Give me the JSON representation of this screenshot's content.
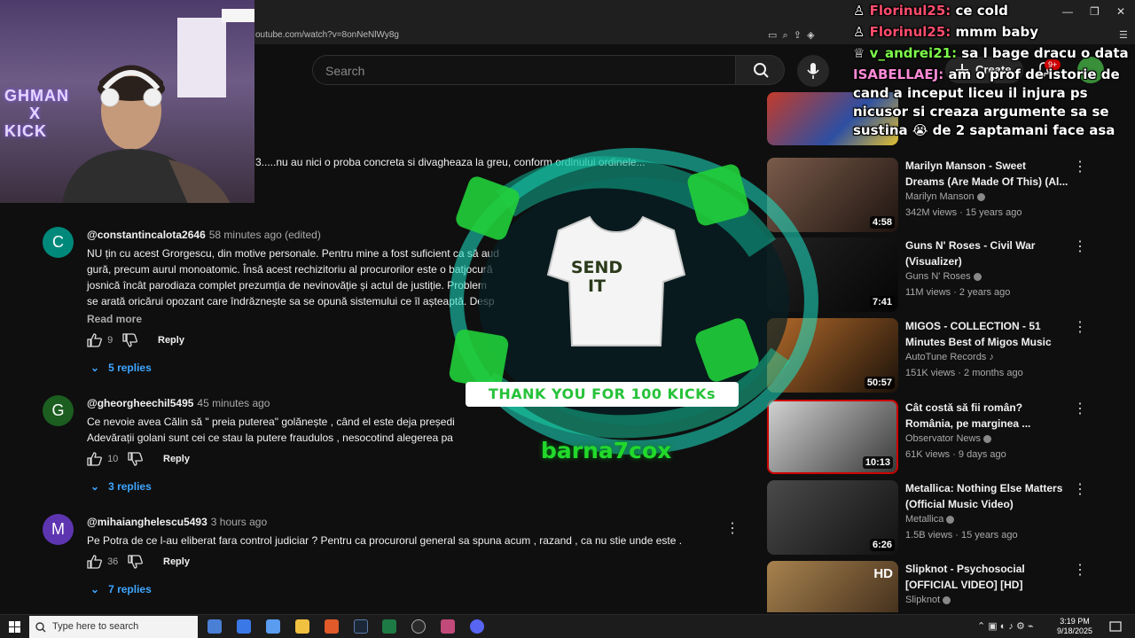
{
  "browser": {
    "url": "outube.com/watch?v=8onNeNlWy8g"
  },
  "header": {
    "search_placeholder": "Search",
    "create_label": "Create",
    "notif_badge": "9+"
  },
  "cut_comment_text": "3.....nu au  nici o proba concreta si divagheaza la greu, conform ordinului ordinele...",
  "comments": [
    {
      "initial": "C",
      "avatar_color": "#00897b",
      "author": "@constantincalota2646",
      "time": "58 minutes ago (edited)",
      "lines": [
        "NU țin cu acest Grorgescu, din motive personale. Pentru mine a fost suficient ca să aud",
        "gură, precum aurul monoatomic. Însă acest rechizitoriu al procurorilor este o batjocură",
        "josnică încât parodiaza complet prezumția de nevinovăție și actul de justiție. Problem",
        "se arată oricărui opozant care îndrăznește sa se opună sistemului ce îl așteaptă. Desp"
      ],
      "read_more": "Read more",
      "likes": "9",
      "reply": "Reply",
      "replies": "5 replies"
    },
    {
      "initial": "G",
      "avatar_color": "#1b5e20",
      "author": "@gheorgheechil5495",
      "time": "45 minutes ago",
      "lines": [
        "Ce nevoie avea Călin să \" preia puterea\" golănește , când el este deja președi",
        "Adevărații golani sunt cei ce stau la putere fraudulos , nesocotind alegerea pa"
      ],
      "likes": "10",
      "reply": "Reply",
      "replies": "3 replies"
    },
    {
      "initial": "M",
      "avatar_color": "#5e35b1",
      "author": "@mihaianghelescu5493",
      "time": "3 hours ago",
      "lines": [
        "Pe Potra de ce l-au eliberat fara control judiciar ?  Pentru ca procurorul general sa spuna acum , razand , ca nu stie unde este ."
      ],
      "likes": "36",
      "reply": "Reply",
      "replies": "7 replies"
    }
  ],
  "recommendations": [
    {
      "title_l1": "Marilyn Manson - Sweet",
      "title_l2": "Dreams (Are Made Of This) (Al...",
      "channel": "Marilyn Manson",
      "meta": "342M views · 15 years ago",
      "duration": "4:58",
      "thumb_color": "#3a2a24"
    },
    {
      "title_l1": "Guns N' Roses - Civil War",
      "title_l2": "(Visualizer)",
      "channel": "Guns N' Roses",
      "meta": "11M views · 2 years ago",
      "duration": "7:41",
      "thumb_color": "#111111"
    },
    {
      "title_l1": "MIGOS - COLLECTION - 51",
      "title_l2": "Minutes Best of Migos Music",
      "channel": "AutoTune Records ♪",
      "meta": "151K views · 2 months ago",
      "duration": "50:57",
      "thumb_color": "#5a3a1e"
    },
    {
      "title_l1": "Cât costă să fii român?",
      "title_l2": "România, pe marginea ...",
      "channel": "Observator News",
      "meta": "61K views · 9 days ago",
      "duration": "10:13",
      "thumb_color": "#8d8d8d"
    },
    {
      "title_l1": "Metallica: Nothing Else Matters",
      "title_l2": "(Official Music Video)",
      "channel": "Metallica",
      "meta": "1.5B views · 15 years ago",
      "duration": "6:26",
      "thumb_color": "#2b2b2b"
    },
    {
      "title_l1": "Slipknot - Psychosocial",
      "title_l2": "[OFFICIAL VIDEO] [HD]",
      "channel": "Slipknot",
      "meta": "",
      "duration": "",
      "thumb_color": "#6b5030"
    }
  ],
  "webcam_text_l1": "GHMAN",
  "webcam_text_l2": "X",
  "webcam_text_l3": "KICK",
  "chat": [
    {
      "user": "Florinul25:",
      "text": " ce cold",
      "style": "red"
    },
    {
      "user": "Florinul25:",
      "text": " mmm baby",
      "style": "red"
    },
    {
      "user": "v_andrei21:",
      "text": " sa l bage dracu o data",
      "style": "green"
    },
    {
      "user": "ISABELLAEJ:",
      "text": " am o prof de istorie de cand a inceput liceu il injura ps nicusor si creaza argumente sa se sustina 😭 de 2 saptamani face asa",
      "style": "pink"
    }
  ],
  "alert": {
    "shirt_l1": "SEND",
    "shirt_l2": "IT",
    "banner": "THANK YOU FOR 100 KICKs",
    "username": "barna7cox"
  },
  "taskbar": {
    "search_placeholder": "Type here to search",
    "time": "3:19 PM",
    "date": "9/18/2025"
  }
}
